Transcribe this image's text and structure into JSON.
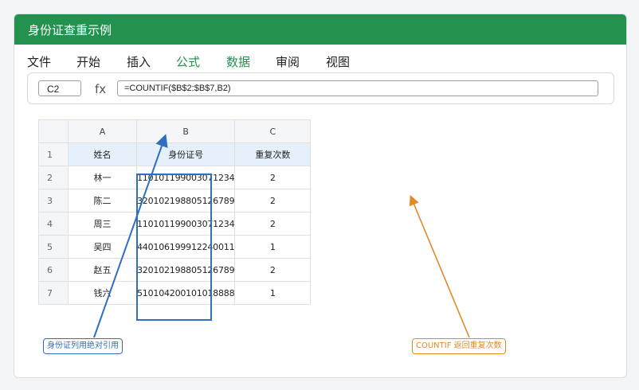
{
  "window": {
    "title": "身份证查重示例"
  },
  "menu": {
    "items": [
      "文件",
      "开始",
      "插入",
      "公式",
      "数据",
      "审阅",
      "视图"
    ]
  },
  "formula_bar": {
    "name_box": "C2",
    "fx_label": "fx",
    "formula": "=COUNTIF($B$2:$B$7,B2)"
  },
  "sheet": {
    "columns": [
      "A",
      "B",
      "C"
    ],
    "header_row": {
      "num": "1",
      "cells": [
        "姓名",
        "身份证号",
        "重复次数"
      ]
    },
    "rows": [
      {
        "num": "2",
        "name": "林一",
        "id": "110101199003071234",
        "count": "2"
      },
      {
        "num": "3",
        "name": "陈二",
        "id": "320102198805126789",
        "count": "2"
      },
      {
        "num": "4",
        "name": "周三",
        "id": "110101199003071234",
        "count": "2"
      },
      {
        "num": "5",
        "name": "吴四",
        "id": "440106199912240011",
        "count": "1"
      },
      {
        "num": "6",
        "name": "赵五",
        "id": "320102198805126789",
        "count": "2"
      },
      {
        "num": "7",
        "name": "钱六",
        "id": "510104200101018888",
        "count": "1"
      }
    ]
  },
  "annotations": {
    "left": "身份证列用绝对引用",
    "right": "COUNTIF 返回重复次数",
    "colors": {
      "blue": "#2f6fbf",
      "orange": "#e08a2c",
      "title_bar": "#22924e"
    }
  }
}
